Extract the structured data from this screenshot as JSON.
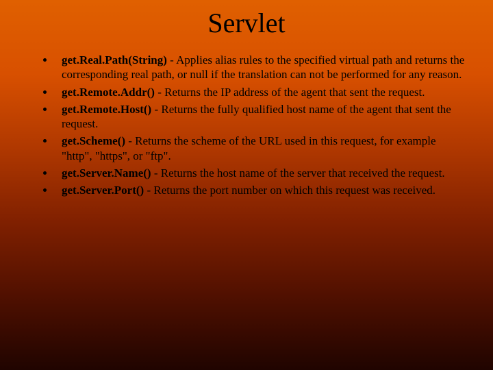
{
  "title": "Servlet",
  "items": [
    {
      "method": "get.Real.Path(String)",
      "desc": " - Applies alias rules to the specified virtual path and returns the corresponding real path, or null if the translation can not be performed for any reason."
    },
    {
      "method": "get.Remote.Addr()",
      "desc": " - Returns the IP address of the agent that sent the request."
    },
    {
      "method": "get.Remote.Host()",
      "desc": " - Returns the fully qualified host name of the agent that sent the request."
    },
    {
      "method": "get.Scheme()",
      "desc": " - Returns the scheme of the URL used in this request, for example \"http\", \"https\", or \"ftp\"."
    },
    {
      "method": "get.Server.Name()",
      "desc": " - Returns the host name of the server that received the request."
    },
    {
      "method": "get.Server.Port()",
      "desc": " - Returns the port number on which this request was received."
    }
  ]
}
